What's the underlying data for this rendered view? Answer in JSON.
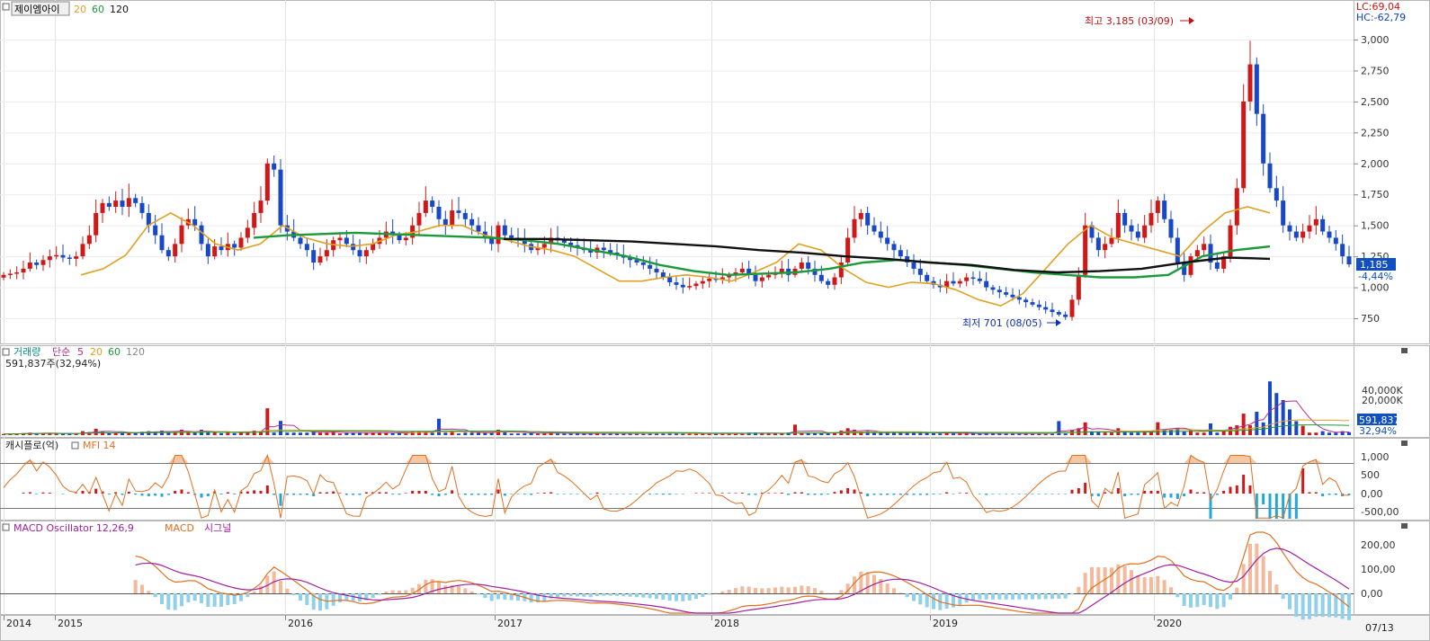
{
  "stock_name": "제이엠아이",
  "ma_labels": [
    "20",
    "60",
    "120"
  ],
  "ma_colors": {
    "ma20": "#e0a020",
    "ma60": "#1a9a3a",
    "ma120": "#111111"
  },
  "price_panel": {
    "lc_label": "LC:69,04",
    "hc_label": "HC:-62,79",
    "high_annotation": "최고 3,185 (03/09)",
    "low_annotation": "최저 701 (08/05)",
    "current_price": "1,185",
    "change_pct": "-4,44%",
    "y_ticks": [
      "3,000",
      "2,750",
      "2,500",
      "2,250",
      "2,000",
      "1,750",
      "1,500",
      "1,250",
      "1,000",
      "750"
    ]
  },
  "volume_panel": {
    "title": "거래량",
    "sub": [
      "단순",
      "5",
      "20",
      "60",
      "120"
    ],
    "info": "591,837주(32,94%)",
    "current": "591,837",
    "pct": "32,94%",
    "y_ticks": [
      "40,000K",
      "20,000K"
    ]
  },
  "cash_panel": {
    "title": "캐시플로(억)",
    "sub": "MFI 14",
    "y_ticks": [
      "1,000",
      "500",
      "0,00",
      "-500,00"
    ]
  },
  "macd_panel": {
    "title": "MACD Oscillator 12,26,9",
    "sub1": "MACD",
    "sub2": "시그널",
    "y_ticks": [
      "200,00",
      "100,00",
      "0,00"
    ]
  },
  "x_axis": {
    "labels": [
      "2014",
      "2015",
      "2016",
      "2017",
      "2018",
      "2019",
      "2020"
    ],
    "right_label": "07/13"
  },
  "chart_data": {
    "type": "candlestick",
    "title": "제이엠아이",
    "x_range": [
      "2014-12",
      "2020-07-13"
    ],
    "ylim": [
      650,
      3200
    ],
    "weekly_close": [
      1100,
      1110,
      1120,
      1150,
      1200,
      1180,
      1220,
      1250,
      1260,
      1240,
      1230,
      1250,
      1350,
      1420,
      1600,
      1680,
      1650,
      1700,
      1650,
      1720,
      1680,
      1600,
      1500,
      1420,
      1300,
      1250,
      1350,
      1500,
      1550,
      1500,
      1350,
      1250,
      1330,
      1300,
      1350,
      1320,
      1400,
      1480,
      1600,
      1700,
      2000,
      1950,
      1500,
      1450,
      1400,
      1350,
      1300,
      1200,
      1250,
      1300,
      1380,
      1400,
      1350,
      1300,
      1250,
      1300,
      1350,
      1400,
      1450,
      1420,
      1380,
      1400,
      1500,
      1600,
      1700,
      1650,
      1550,
      1500,
      1620,
      1600,
      1550,
      1500,
      1450,
      1400,
      1350,
      1500,
      1420,
      1400,
      1380,
      1350,
      1300,
      1320,
      1350,
      1400,
      1380,
      1360,
      1340,
      1320,
      1300,
      1280,
      1320,
      1300,
      1280,
      1260,
      1240,
      1220,
      1200,
      1180,
      1150,
      1120,
      1080,
      1040,
      1020,
      1000,
      1010,
      1030,
      1050,
      1070,
      1060,
      1080,
      1100,
      1120,
      1150,
      1100,
      1050,
      1080,
      1100,
      1120,
      1150,
      1100,
      1150,
      1200,
      1150,
      1100,
      1050,
      1020,
      1080,
      1200,
      1400,
      1550,
      1600,
      1500,
      1450,
      1400,
      1350,
      1300,
      1250,
      1200,
      1150,
      1100,
      1050,
      1020,
      1000,
      1050,
      1030,
      1050,
      1080,
      1070,
      1050,
      1000,
      980,
      960,
      940,
      920,
      900,
      880,
      860,
      840,
      820,
      800,
      780,
      760,
      900,
      1100,
      1500,
      1400,
      1300,
      1350,
      1400,
      1600,
      1500,
      1450,
      1400,
      1500,
      1600,
      1700,
      1550,
      1400,
      1200,
      1100,
      1250,
      1300,
      1350,
      1200,
      1150,
      1250,
      1500,
      1800,
      2500,
      2800,
      2400,
      2000,
      1800,
      1700,
      1500,
      1450,
      1400,
      1450,
      1500,
      1550,
      1450,
      1400,
      1350,
      1250,
      1185
    ],
    "high_point": {
      "value": 3185,
      "label": "최고 3,185 (03/09)"
    },
    "low_point": {
      "value": 701,
      "label": "최저 701 (08/05)"
    },
    "series": [
      {
        "name": "20",
        "values": [
          1100,
          1150,
          1260,
          1500,
          1600,
          1500,
          1350,
          1300,
          1350,
          1500,
          1400,
          1350,
          1330,
          1350,
          1420,
          1450,
          1500,
          1500,
          1420,
          1380,
          1330,
          1300,
          1250,
          1150,
          1050,
          1050,
          1080,
          1100,
          1080,
          1050,
          1120,
          1200,
          1350,
          1300,
          1150,
          1040,
          1000,
          1040,
          1030,
          980,
          900,
          850,
          950,
          1150,
          1350,
          1500,
          1400,
          1350,
          1300,
          1250,
          1450,
          1600,
          1650,
          1600
        ]
      },
      {
        "name": "60",
        "values": [
          1400,
          1420,
          1430,
          1440,
          1430,
          1420,
          1410,
          1400,
          1380,
          1350,
          1300,
          1250,
          1180,
          1130,
          1100,
          1110,
          1120,
          1150,
          1200,
          1220,
          1200,
          1180,
          1150,
          1120,
          1100,
          1080,
          1080,
          1100,
          1250,
          1300,
          1330
        ]
      },
      {
        "name": "120",
        "values": [
          1390,
          1390,
          1380,
          1370,
          1350,
          1330,
          1300,
          1280,
          1250,
          1230,
          1200,
          1180,
          1140,
          1120,
          1130,
          1150,
          1200,
          1240,
          1230
        ]
      }
    ]
  }
}
